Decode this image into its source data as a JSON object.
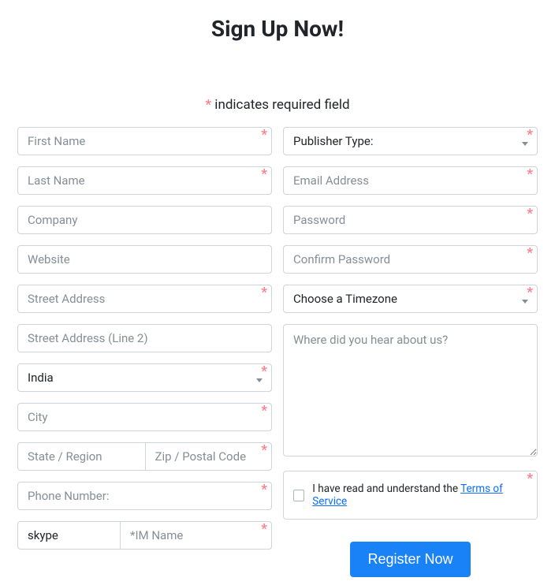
{
  "title": "Sign Up Now!",
  "required_note_prefix": "*",
  "required_note_text": " indicates required field",
  "asterisk": "*",
  "left": {
    "first_name": "First Name",
    "last_name": "Last Name",
    "company": "Company",
    "website": "Website",
    "street1": "Street Address",
    "street2": "Street Address (Line 2)",
    "country_selected": "India",
    "city": "City",
    "state": "State / Region",
    "zip": "Zip / Postal Code",
    "phone": "Phone Number:",
    "im_type_selected": "skype",
    "im_name": "*IM Name"
  },
  "right": {
    "pub_type_selected": "Publisher Type:",
    "email": "Email Address",
    "password": "Password",
    "confirm_password": "Confirm Password",
    "timezone_selected": "Choose a Timezone",
    "hear_about": "Where did you hear about us?",
    "tos_text": "I have read and understand the ",
    "tos_link": "Terms of Service",
    "register_btn": "Register Now"
  }
}
